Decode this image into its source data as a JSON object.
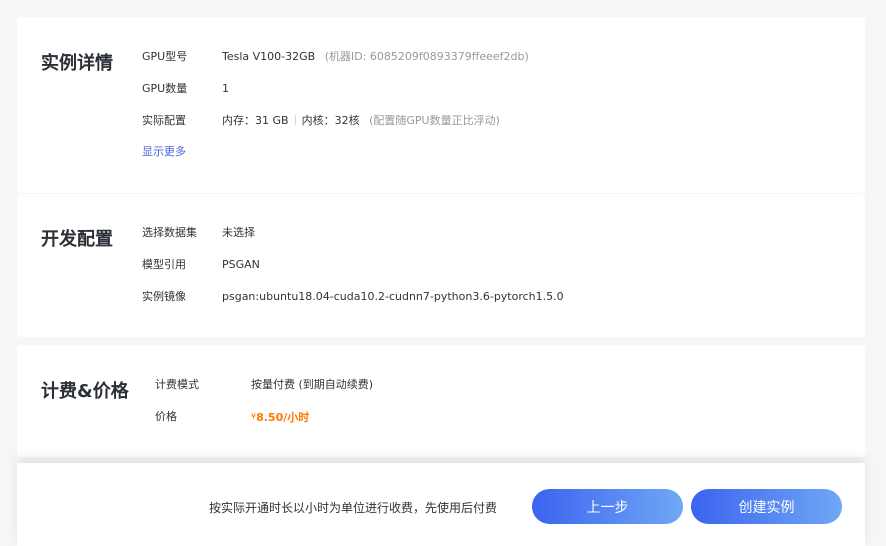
{
  "instance": {
    "title": "实例详情",
    "gpu_model_label": "GPU型号",
    "gpu_model_value": "Tesla V100-32GB",
    "machine_id": "(机器ID: 6085209f0893379ffeeef2db)",
    "gpu_count_label": "GPU数量",
    "gpu_count_value": "1",
    "config_label": "实际配置",
    "memory": "内存：31 GB",
    "cores": "内核：32核",
    "config_note": "(配置随GPU数量正比浮动)",
    "show_more": "显示更多"
  },
  "dev": {
    "title": "开发配置",
    "dataset_label": "选择数据集",
    "dataset_value": "未选择",
    "model_label": "模型引用",
    "model_value": "PSGAN",
    "image_label": "实例镜像",
    "image_value": "psgan:ubuntu18.04-cuda10.2-cudnn7-python3.6-pytorch1.5.0"
  },
  "billing": {
    "title": "计费&价格",
    "mode_label": "计费模式",
    "mode_value": "按量付费 (到期自动续费)",
    "price_label": "价格",
    "currency": "¥",
    "price_value": "8.50/小时"
  },
  "footer": {
    "note": "按实际开通时长以小时为单位进行收费，先使用后付费",
    "prev_label": "上一步",
    "create_label": "创建实例"
  },
  "colors": {
    "accent": "#3b63f0",
    "price": "#ff7a00",
    "link": "#4a66d8"
  }
}
